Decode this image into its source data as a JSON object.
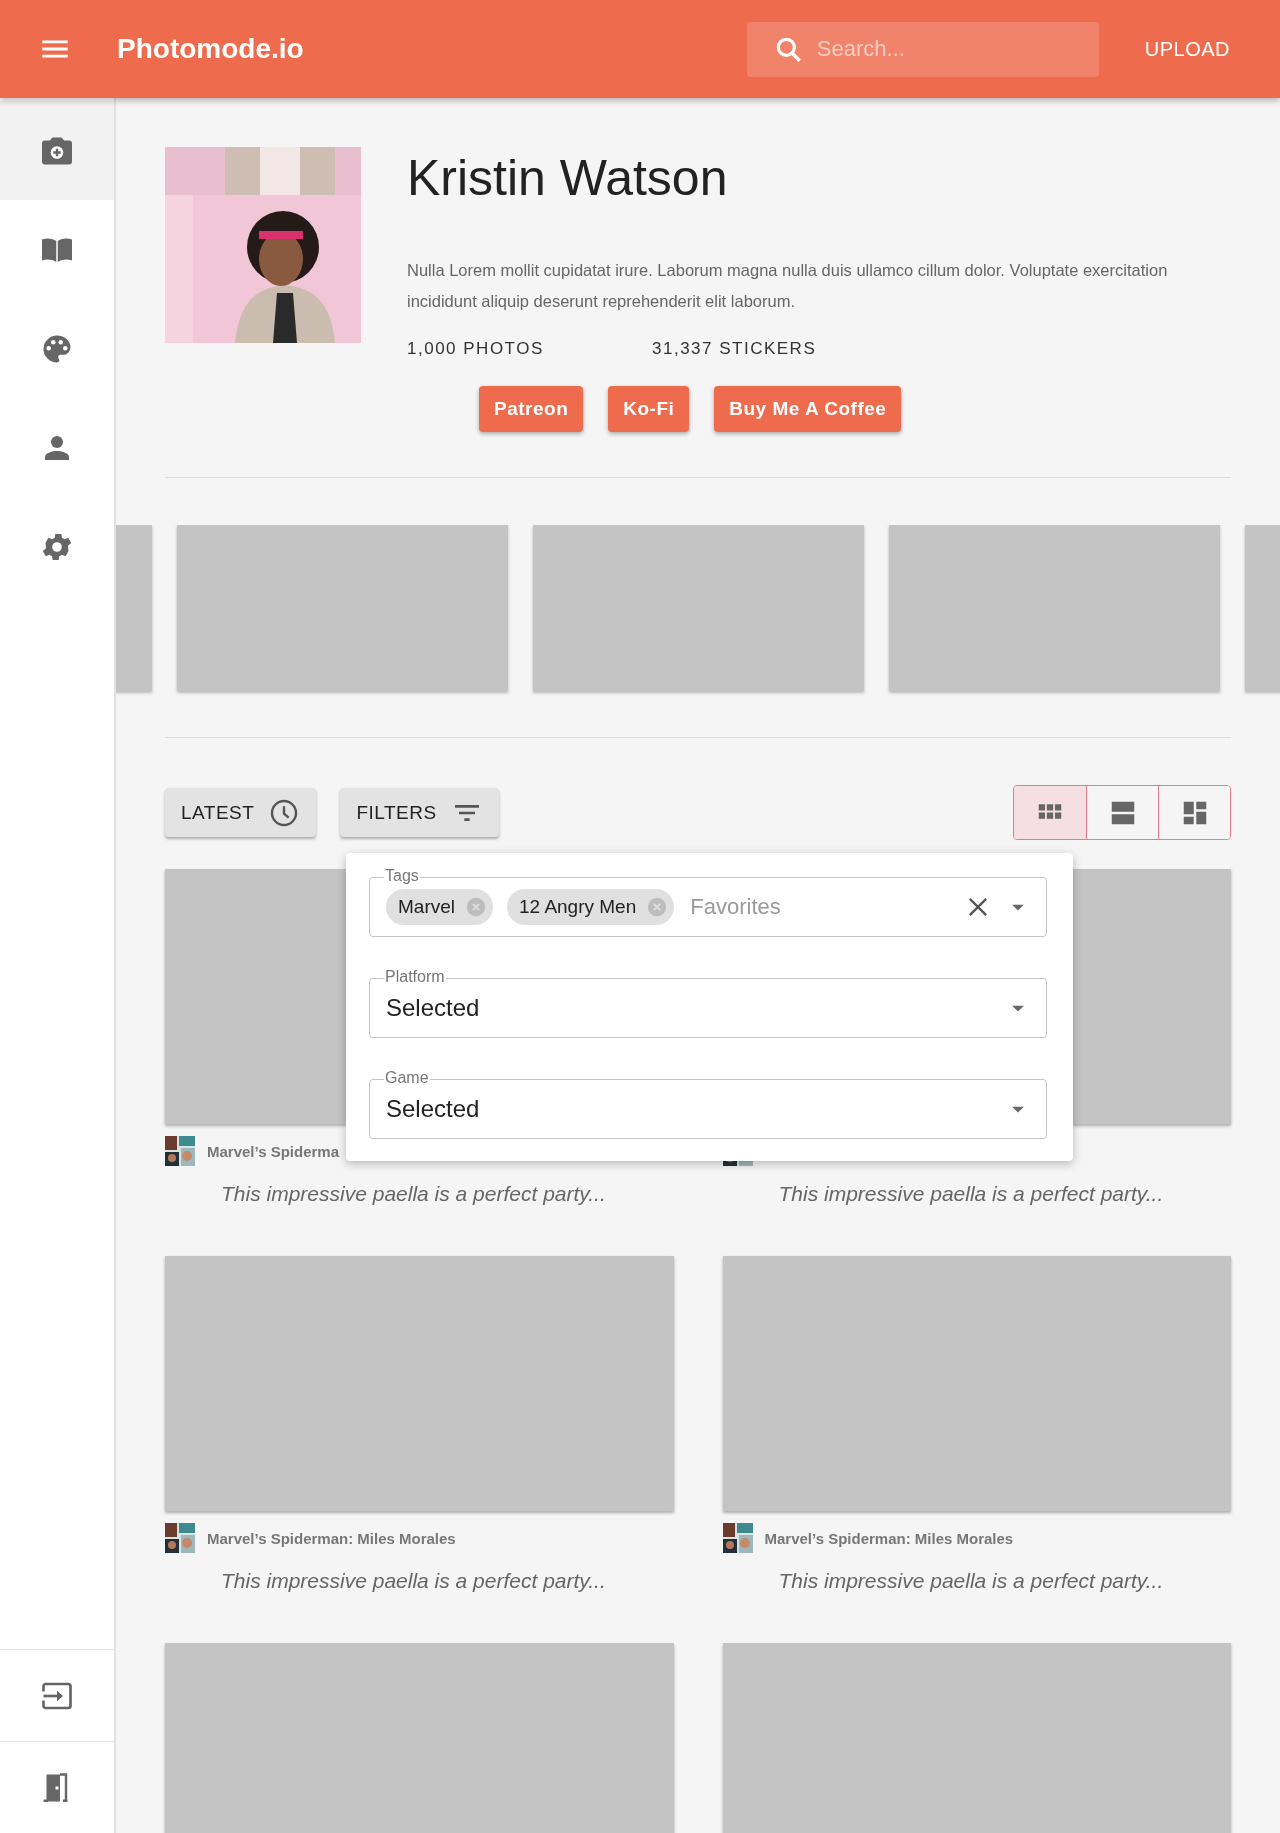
{
  "header": {
    "title": "Photomode.io",
    "search": {
      "placeholder": "Search..."
    },
    "upload": "UPLOAD"
  },
  "sidebar": {
    "items": [
      {
        "kind": "camera",
        "selected": true
      },
      {
        "kind": "book",
        "selected": false
      },
      {
        "kind": "palette",
        "selected": false
      },
      {
        "kind": "person",
        "selected": false
      },
      {
        "kind": "gear",
        "selected": false
      }
    ],
    "bottom_items": [
      {
        "kind": "login",
        "selected": false
      },
      {
        "kind": "door",
        "selected": false
      }
    ]
  },
  "profile": {
    "name": "Kristin Watson",
    "bio": "Nulla Lorem mollit cupidatat irure. Laborum magna nulla duis ullamco cillum dolor. Voluptate exercitation incididunt aliquip deserunt reprehenderit elit laborum.",
    "stats": [
      "1,000 PHOTOS",
      "31,337 STICKERS"
    ],
    "links": [
      "Patreon",
      "Ko-Fi",
      "Buy Me A Coffee"
    ]
  },
  "toolbar": {
    "sort": "LATEST",
    "filters": "FILTERS",
    "views": [
      {
        "kind": "grid",
        "selected": true
      },
      {
        "kind": "rows",
        "selected": false
      },
      {
        "kind": "mosaic",
        "selected": false
      }
    ]
  },
  "filter_panel": {
    "fields": [
      {
        "kind": "tags",
        "label": "Tags",
        "chips": [
          "Marvel",
          "12 Angry Men"
        ],
        "placeholder": "Favorites"
      },
      {
        "kind": "select",
        "label": "Platform",
        "value": "Selected"
      },
      {
        "kind": "select",
        "label": "Game",
        "value": "Selected"
      }
    ]
  },
  "posts": [
    {
      "kind": "post",
      "title": "Marvel’s Spiderma",
      "description": "This impressive paella is a perfect party..."
    },
    {
      "kind": "post",
      "description": "This impressive paella is a perfect party..."
    },
    {
      "kind": "post",
      "title": "Marvel’s Spiderman: Miles Morales",
      "description": "This impressive paella is a perfect party..."
    },
    {
      "kind": "post",
      "title": "Marvel’s Spiderman: Miles Morales",
      "description": "This impressive paella is a perfect party..."
    },
    {
      "kind": "placeholder"
    },
    {
      "kind": "placeholder"
    }
  ]
}
